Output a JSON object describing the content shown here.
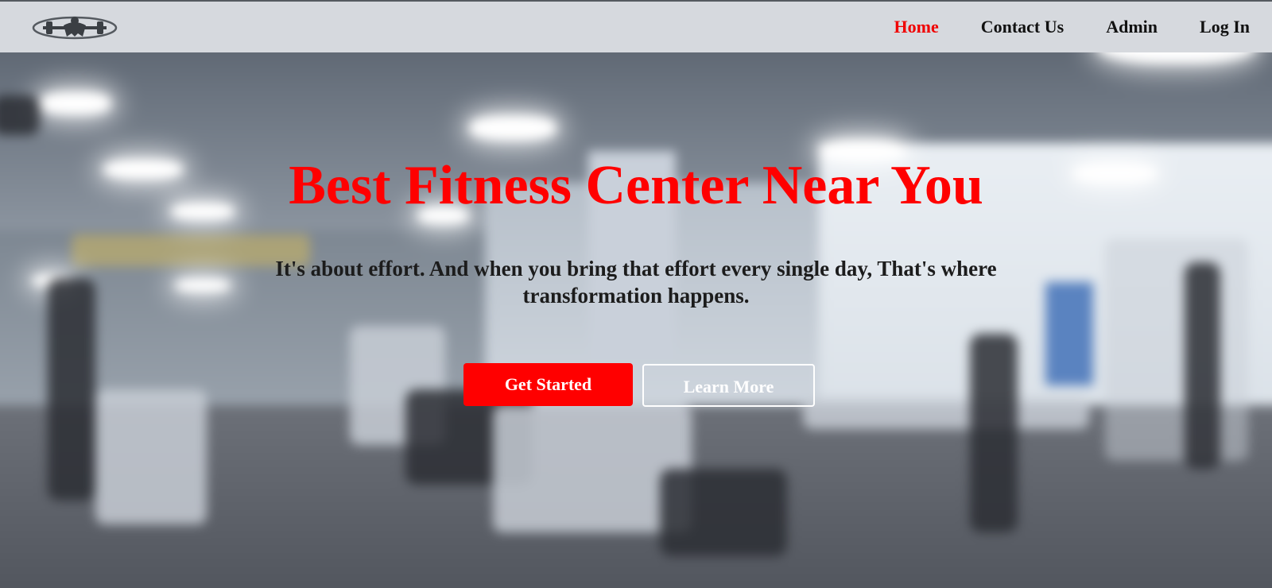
{
  "nav": {
    "logo_icon": "gym-lifter-logo-icon",
    "links": [
      {
        "label": "Home",
        "active": true
      },
      {
        "label": "Contact Us",
        "active": false
      },
      {
        "label": "Admin",
        "active": false
      },
      {
        "label": "Log In",
        "active": false
      }
    ]
  },
  "hero": {
    "title": "Best Fitness Center Near You",
    "subtitle": "It's about effort. And when you bring that effort every single day, That's where transformation happens.",
    "primary_button": "Get Started",
    "secondary_button": "Learn More"
  },
  "colors": {
    "accent": "#ff0000",
    "nav_background": "#d6d9de",
    "nav_text": "#111111"
  }
}
